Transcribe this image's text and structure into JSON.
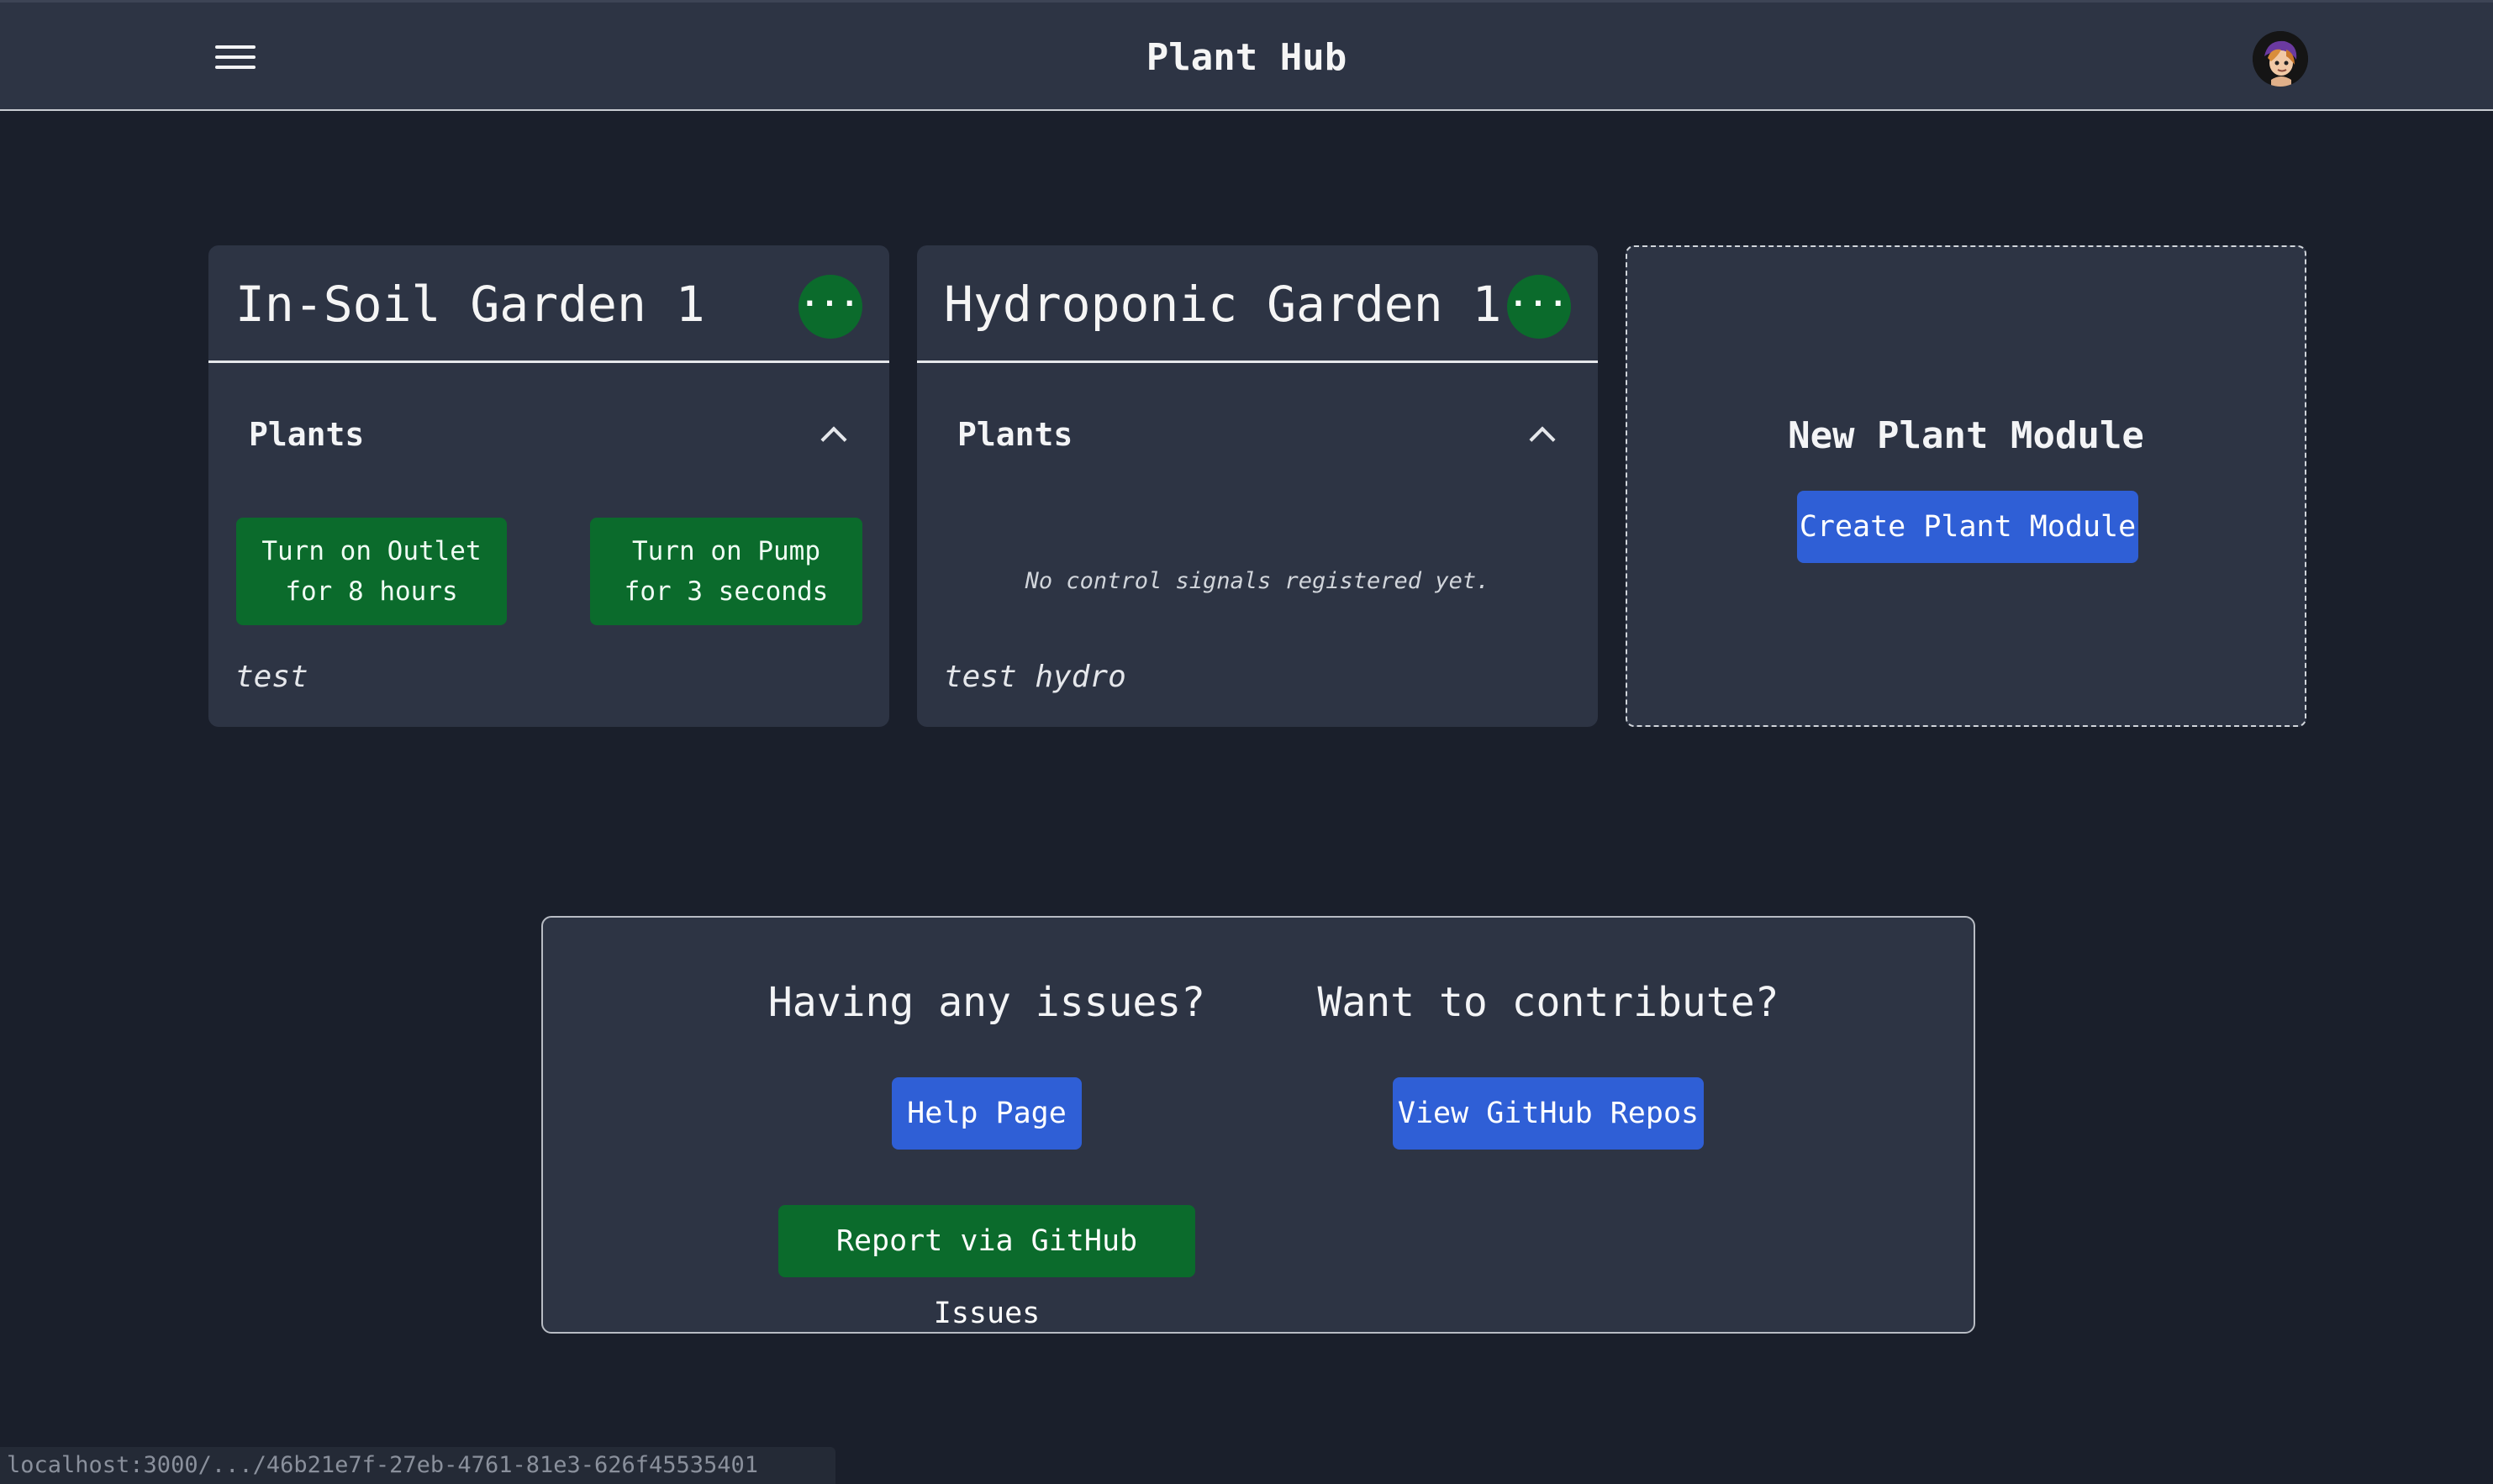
{
  "header": {
    "title": "Plant Hub"
  },
  "modules": [
    {
      "title": "In-Soil Garden 1",
      "more_label": "···",
      "section_label": "Plants",
      "signals": [
        "Turn on Outlet for 8 hours",
        "Turn on Pump for 3 seconds"
      ],
      "note": "test"
    },
    {
      "title": "Hydroponic Garden 1",
      "more_label": "···",
      "section_label": "Plants",
      "empty_text": "No control signals registered yet.",
      "note": "test hydro"
    }
  ],
  "new_module": {
    "title": "New Plant Module",
    "button_label": "Create Plant Module"
  },
  "support": {
    "issues_heading": "Having any issues?",
    "help_button": "Help Page",
    "report_button": "Report via GitHub Issues",
    "contribute_heading": "Want to contribute?",
    "repos_button": "View GitHub Repos"
  },
  "status_bar": {
    "url": "localhost:3000/.../46b21e7f-27eb-4761-81e3-626f45535401"
  },
  "colors": {
    "background": "#1a1f2b",
    "card": "#2d3444",
    "green": "#0b6b2c",
    "blue": "#2f5fd6"
  },
  "icons": [
    "menu-icon",
    "more-horizontal-icon",
    "chevron-up-icon",
    "avatar"
  ]
}
